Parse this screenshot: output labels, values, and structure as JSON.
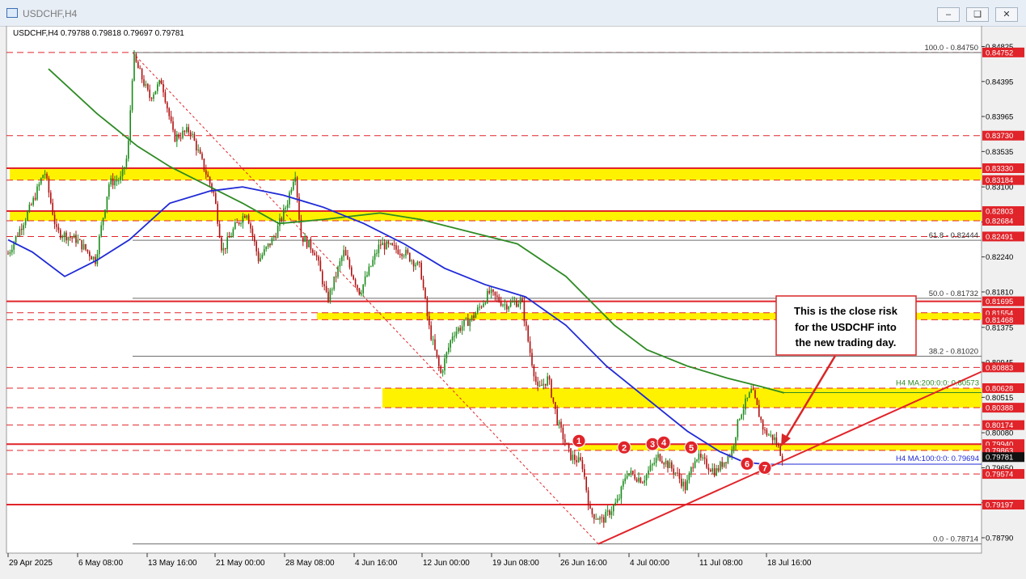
{
  "window": {
    "title": "USDCHF,H4",
    "minimize_icon": "minimize-icon",
    "restore_icon": "restore-icon",
    "close_icon": "close-icon"
  },
  "chart_data": {
    "type": "candlestick",
    "symbol_info": "USDCHF,H4  0.79788 0.79818 0.79697 0.79781",
    "ylim": [
      0.7859,
      0.8488
    ],
    "y_ticks": [
      "0.84825",
      "0.84395",
      "0.83965",
      "0.83535",
      "0.83100",
      "0.82670",
      "0.82240",
      "0.81810",
      "0.81375",
      "0.80945",
      "0.80515",
      "0.80080",
      "0.79650",
      "0.79220",
      "0.78790"
    ],
    "x_ticks": [
      "29 Apr 2025",
      "6 May 08:00",
      "13 May 16:00",
      "21 May 00:00",
      "28 May 08:00",
      "4 Jun 16:00",
      "12 Jun 00:00",
      "19 Jun 08:00",
      "26 Jun 16:00",
      "4 Jul 00:00",
      "11 Jul 08:00",
      "18 Jul 16:00"
    ],
    "price_boxes": [
      {
        "label": "0.84752",
        "value": 0.84752,
        "color": "#e0242a"
      },
      {
        "label": "0.83730",
        "value": 0.8373,
        "color": "#e0242a"
      },
      {
        "label": "0.83330",
        "value": 0.8333,
        "color": "#e0242a"
      },
      {
        "label": "0.83184",
        "value": 0.83184,
        "color": "#e0242a"
      },
      {
        "label": "0.82803",
        "value": 0.82803,
        "color": "#e0242a"
      },
      {
        "label": "0.82684",
        "value": 0.82684,
        "color": "#e0242a"
      },
      {
        "label": "0.82491",
        "value": 0.82491,
        "color": "#e0242a"
      },
      {
        "label": "0.81695",
        "value": 0.81695,
        "color": "#e0242a"
      },
      {
        "label": "0.81554",
        "value": 0.81554,
        "color": "#e0242a"
      },
      {
        "label": "0.81468",
        "value": 0.81468,
        "color": "#e0242a"
      },
      {
        "label": "0.80883",
        "value": 0.80883,
        "color": "#e0242a"
      },
      {
        "label": "0.80628",
        "value": 0.80628,
        "color": "#e0242a"
      },
      {
        "label": "0.80388",
        "value": 0.80388,
        "color": "#e0242a"
      },
      {
        "label": "0.80174",
        "value": 0.80174,
        "color": "#e0242a"
      },
      {
        "label": "0.79940",
        "value": 0.7994,
        "color": "#e0242a"
      },
      {
        "label": "0.79863",
        "value": 0.79863,
        "color": "#e0242a"
      },
      {
        "label": "0.79781",
        "value": 0.79781,
        "color": "#111111"
      },
      {
        "label": "0.79574",
        "value": 0.79574,
        "color": "#e0242a"
      },
      {
        "label": "0.79197",
        "value": 0.79197,
        "color": "#e0242a"
      }
    ],
    "fib_labels": [
      {
        "label": "100.0 - 0.84750",
        "value": 0.8475
      },
      {
        "label": "61.8 - 0.82444",
        "value": 0.82444
      },
      {
        "label": "50.0 - 0.81732",
        "value": 0.81732
      },
      {
        "label": "38.2 - 0.81020",
        "value": 0.8102
      },
      {
        "label": "0.0 - 0.78714",
        "value": 0.78714
      }
    ],
    "ma_labels": {
      "ma200": "H4 MA:200:0:0: 0.80573",
      "ma100": "H4 MA:100:0:0: 0.79694"
    },
    "zones": [
      {
        "from": 0.83184,
        "to": 0.8333
      },
      {
        "from": 0.82684,
        "to": 0.82803
      },
      {
        "from": 0.81468,
        "to": 0.81554
      },
      {
        "from": 0.80388,
        "to": 0.80628
      },
      {
        "from": 0.79863,
        "to": 0.7994
      }
    ],
    "markers": [
      "1",
      "2",
      "3",
      "4",
      "5",
      "6",
      "7"
    ],
    "annotation": [
      "This is the close risk",
      "for the USDCHF into",
      "the new trading day."
    ],
    "series": [
      {
        "name": "H4 MA:200",
        "color": "#2e8b24"
      },
      {
        "name": "H4 MA:100",
        "color": "#1f2ad6"
      }
    ]
  }
}
